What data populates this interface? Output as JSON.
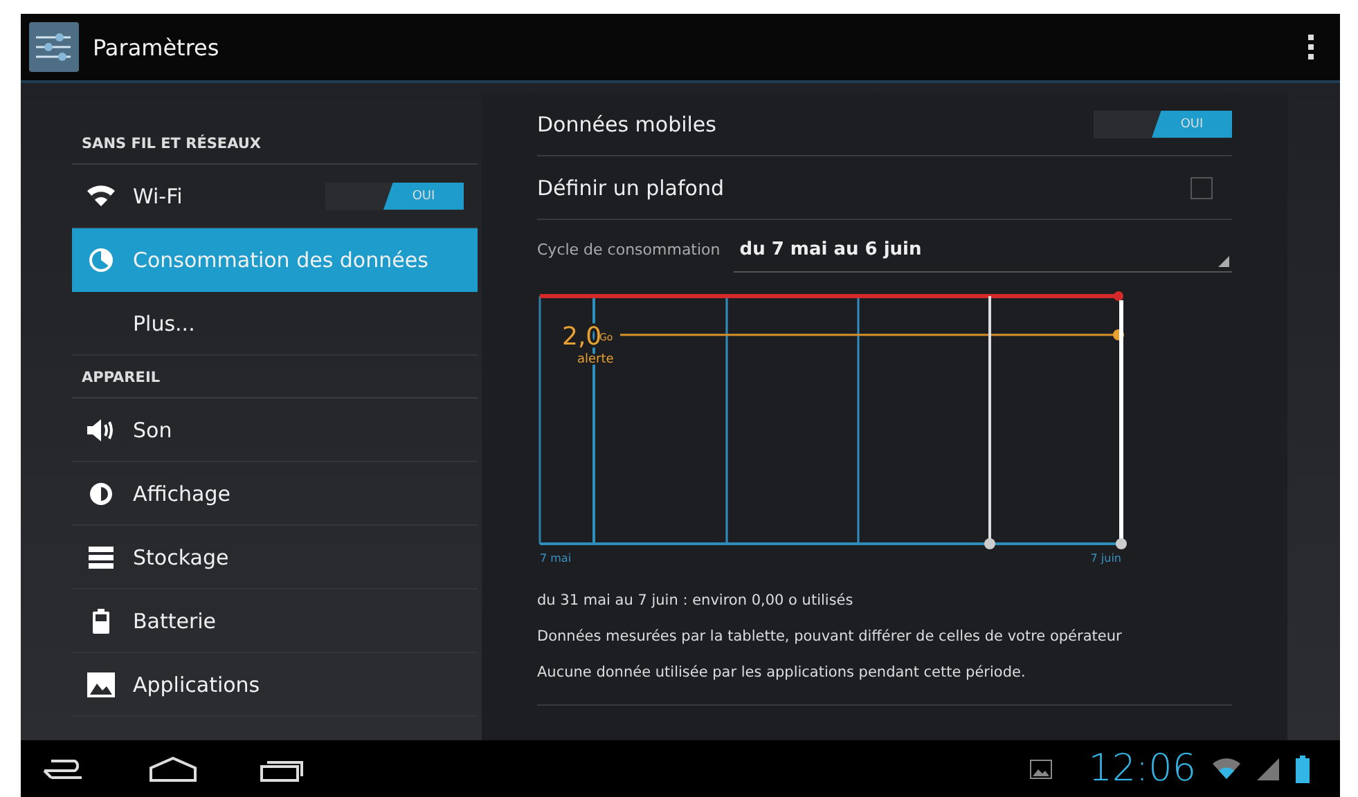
{
  "title_bar": {
    "title": "Paramètres"
  },
  "sidebar": {
    "sections": [
      {
        "header": "SANS FIL ET RÉSEAUX",
        "items": [
          {
            "label": "Wi-Fi",
            "kind": "wifi",
            "selected": false,
            "toggle": {
              "on": true,
              "label": "OUI"
            }
          },
          {
            "label": "Consommation des données",
            "kind": "data",
            "selected": true
          },
          {
            "label": "Plus...",
            "kind": "plain",
            "selected": false
          }
        ]
      },
      {
        "header": "APPAREIL",
        "items": [
          {
            "label": "Son",
            "kind": "sound",
            "selected": false
          },
          {
            "label": "Affichage",
            "kind": "display",
            "selected": false
          },
          {
            "label": "Stockage",
            "kind": "storage",
            "selected": false
          },
          {
            "label": "Batterie",
            "kind": "battery",
            "selected": false
          },
          {
            "label": "Applications",
            "kind": "apps",
            "selected": false
          }
        ]
      }
    ]
  },
  "data_usage": {
    "mobile_data": {
      "label": "Données mobiles",
      "on": true,
      "toggle_label": "OUI"
    },
    "set_limit": {
      "label": "Définir un plafond",
      "checked": false
    },
    "cycle": {
      "label": "Cycle de consommation",
      "value": "du 7 mai au 6 juin"
    },
    "graph": {
      "warning_value": "2,0",
      "warning_unit": "Go",
      "warning_label": "alerte",
      "start_label": "7 mai",
      "end_label": "7 juin"
    },
    "notes": [
      "du 31 mai au 7 juin : environ 0,00 o utilisés",
      "Données mesurées par la tablette, pouvant différer de celles de votre opérateur",
      "Aucune donnée utilisée par les applications pendant cette période."
    ]
  },
  "status_bar": {
    "time": "12:06"
  }
}
